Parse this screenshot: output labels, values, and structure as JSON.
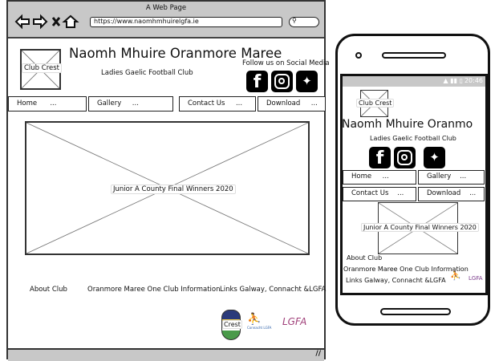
{
  "browser": {
    "title": "A Web Page",
    "url": "https://www.naomhmhuirelgfa.ie",
    "icons": [
      "back-arrow-icon",
      "forward-arrow-icon",
      "close-x-icon",
      "home-icon",
      "search-icon"
    ]
  },
  "site": {
    "crest_label": "Club Crest",
    "title": "Naomh Mhuire Oranmore Maree",
    "subtitle": "Ladies Gaelic Football Club",
    "follow": "Follow us on Social Media",
    "social": [
      "facebook-icon",
      "instagram-icon",
      "twitter-icon"
    ],
    "nav": [
      {
        "label": "Home",
        "more": "..."
      },
      {
        "label": "Gallery",
        "more": "..."
      },
      {
        "label": "Contact Us",
        "more": "..."
      },
      {
        "label": "Download",
        "more": "..."
      }
    ],
    "hero_label": "Junior A County Final Winners 2020",
    "footer_links": [
      "About Club",
      "Oranmore Maree One Club Information",
      "Links Galway, Connacht &LGFA"
    ],
    "logos": {
      "crest": "Crest",
      "connacht": "Connacht LGFA",
      "lgfa": "LGFA"
    }
  },
  "mobile": {
    "time": "20:46",
    "title_truncated": "Naomh Mhuire Oranmo"
  }
}
